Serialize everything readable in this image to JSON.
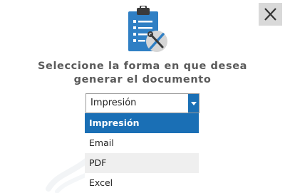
{
  "dialog": {
    "close_icon": "close-x-icon",
    "header_icon": "clipboard-checklist-tools-icon",
    "prompt_line1": "Seleccione la forma en que desea",
    "prompt_line2": "generar el documento"
  },
  "format_select": {
    "value": "Impresión",
    "arrow_icon": "chevron-down-icon",
    "options": [
      {
        "label": "Impresión",
        "state": "selected"
      },
      {
        "label": "Email",
        "state": "normal"
      },
      {
        "label": "PDF",
        "state": "hover"
      },
      {
        "label": "Excel",
        "state": "normal"
      }
    ]
  },
  "colors": {
    "accent": "#1a6fb5",
    "close_button_bg": "#d9d9d9",
    "prompt_text": "#5a5a5a",
    "hover_bg": "#efefef"
  }
}
